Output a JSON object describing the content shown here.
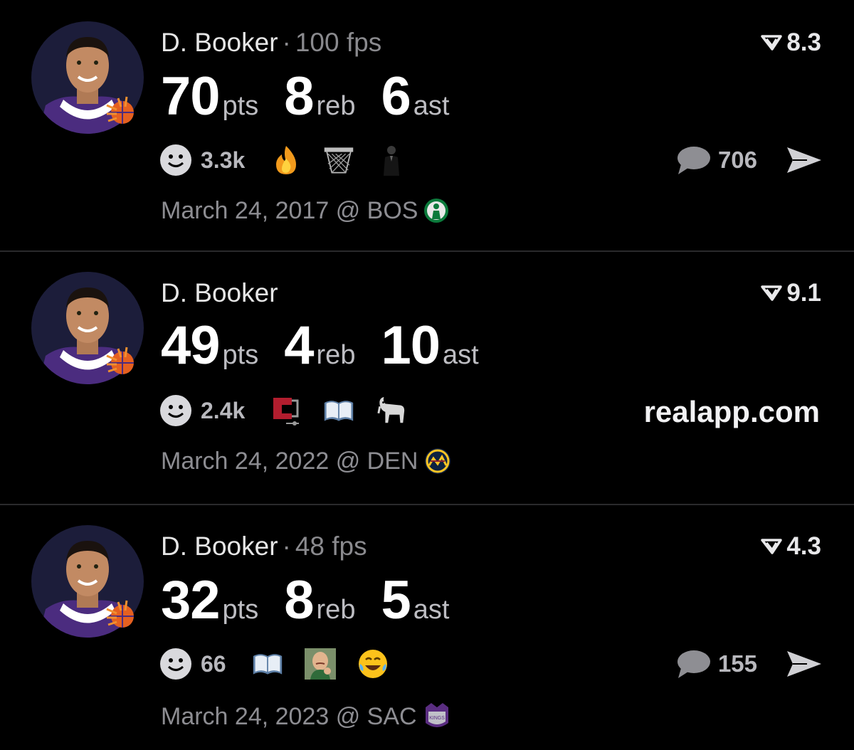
{
  "cards": [
    {
      "name": "D. Booker",
      "separator": "·",
      "fps": "100 fps",
      "rating": "8.3",
      "stats": {
        "pts": "70",
        "pts_label": "pts",
        "reb": "8",
        "reb_label": "reb",
        "ast": "6",
        "ast_label": "ast"
      },
      "reaction_count": "3.3k",
      "reaction_icons": [
        "fire-emoji",
        "basketball-hoop-emoji",
        "person-in-suit-emoji"
      ],
      "comment_count": "706",
      "date": "March 24, 2017 @ BOS",
      "team_logo": "celtics-logo"
    },
    {
      "name": "D. Booker",
      "rating": "9.1",
      "stats": {
        "pts": "49",
        "pts_label": "pts",
        "reb": "4",
        "reb_label": "reb",
        "ast": "10",
        "ast_label": "ast"
      },
      "reaction_count": "2.4k",
      "reaction_icons": [
        "clamp-emoji",
        "open-book-emoji",
        "goat-emoji"
      ],
      "site": "realapp.com",
      "date": "March 24, 2022 @ DEN",
      "team_logo": "nuggets-logo"
    },
    {
      "name": "D. Booker",
      "separator": "·",
      "fps": "48 fps",
      "rating": "4.3",
      "stats": {
        "pts": "32",
        "pts_label": "pts",
        "reb": "8",
        "reb_label": "reb",
        "ast": "5",
        "ast_label": "ast"
      },
      "reaction_count": "66",
      "reaction_icons": [
        "open-book-emoji",
        "success-kid-emoji",
        "laughing-tears-emoji"
      ],
      "comment_count": "155",
      "date": "March 24, 2023 @ SAC",
      "team_logo": "kings-logo"
    }
  ],
  "colors": {
    "background": "#000000",
    "text": "#ffffff",
    "muted": "#8a8a8e",
    "divider": "#2a2a2c",
    "suns_purple": "#4b2c7f",
    "suns_orange": "#e56020"
  }
}
